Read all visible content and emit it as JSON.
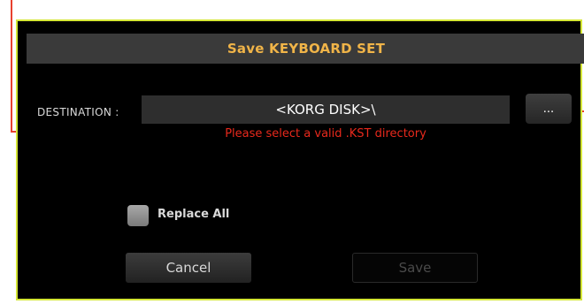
{
  "dialog": {
    "title": "Save KEYBOARD SET",
    "destination_label": "DESTINATION :",
    "destination_value": "<KORG DISK>\\",
    "browse_label": "...",
    "error_message": "Please select a valid .KST directory",
    "replace_all_label": "Replace All",
    "replace_all_checked": false,
    "cancel_label": "Cancel",
    "save_label": "Save",
    "save_enabled": false
  },
  "colors": {
    "title_text": "#f0b448",
    "error_text": "#e8291c",
    "highlight_border": "#d4e636",
    "callout": "#e8412e"
  }
}
